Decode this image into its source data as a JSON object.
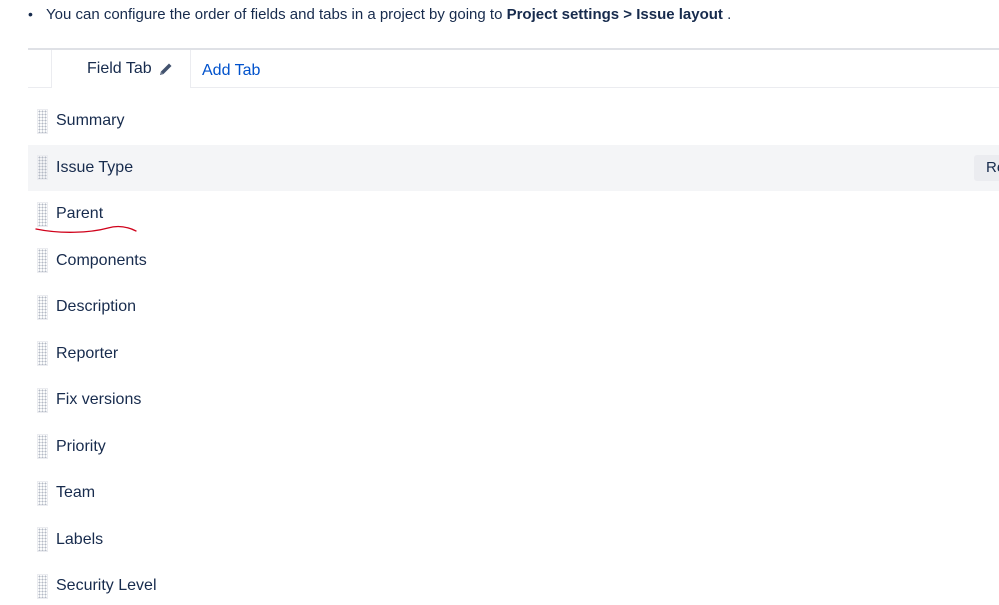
{
  "note": {
    "bullet": "•",
    "text_before": "You can configure the order of fields and tabs in a project by going to ",
    "bold_path": "Project settings > Issue layout",
    "text_after": " ."
  },
  "tabs": {
    "field_tab_label": "Field Tab",
    "add_tab_label": "Add Tab"
  },
  "fields": [
    {
      "label": "Summary"
    },
    {
      "label": "Issue Type",
      "action": "Re"
    },
    {
      "label": "Parent"
    },
    {
      "label": "Components"
    },
    {
      "label": "Description"
    },
    {
      "label": "Reporter"
    },
    {
      "label": "Fix versions"
    },
    {
      "label": "Priority"
    },
    {
      "label": "Team"
    },
    {
      "label": "Labels"
    },
    {
      "label": "Security Level"
    }
  ],
  "colors": {
    "link": "#0052cc",
    "text": "#172b4d",
    "row_highlight": "#f4f5f7",
    "annotation": "#d0021b"
  }
}
